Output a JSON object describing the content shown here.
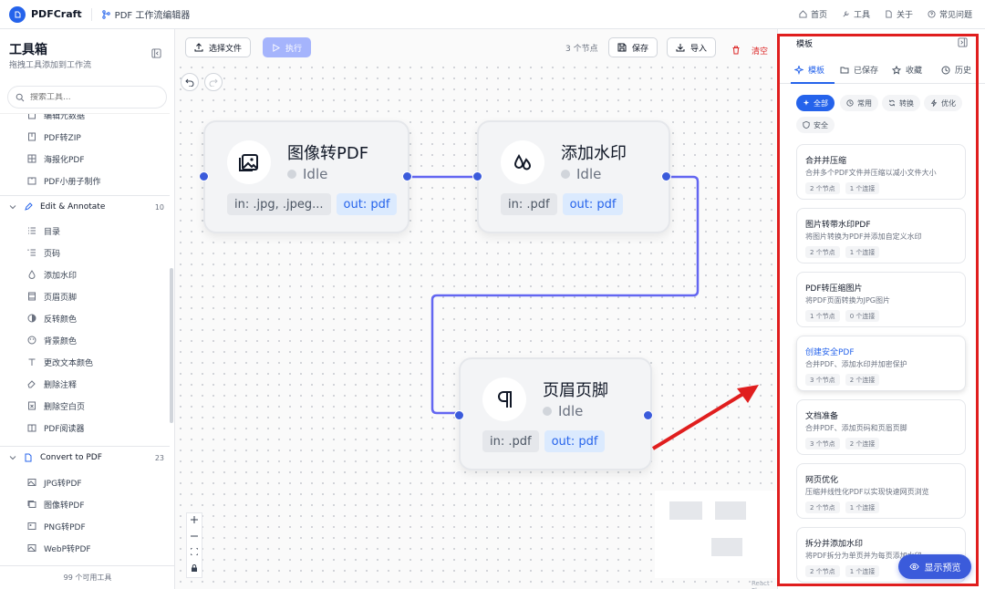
{
  "topbar": {
    "brand": "PDFCraft",
    "breadcrumb": "PDF 工作流编辑器",
    "nav": {
      "home": "首页",
      "tools": "工具",
      "about": "关于",
      "faq": "常见问题"
    }
  },
  "sidebar": {
    "title": "工具箱",
    "subtitle": "拖拽工具添加到工作流",
    "search_placeholder": "搜索工具...",
    "items_top": [
      {
        "label": "编辑元数据",
        "icon": "metadata-icon"
      },
      {
        "label": "PDF转ZIP",
        "icon": "zip-icon"
      },
      {
        "label": "海报化PDF",
        "icon": "poster-icon"
      },
      {
        "label": "PDF小册子制作",
        "icon": "booklet-icon"
      }
    ],
    "category_edit": {
      "label": "Edit & Annotate",
      "count": "10"
    },
    "items_edit": [
      {
        "label": "目录",
        "icon": "list-icon"
      },
      {
        "label": "页码",
        "icon": "numbered-list-icon"
      },
      {
        "label": "添加水印",
        "icon": "droplet-icon"
      },
      {
        "label": "页眉页脚",
        "icon": "header-footer-icon"
      },
      {
        "label": "反转颜色",
        "icon": "invert-icon"
      },
      {
        "label": "背景颜色",
        "icon": "palette-icon"
      },
      {
        "label": "更改文本颜色",
        "icon": "text-icon"
      },
      {
        "label": "删除注释",
        "icon": "eraser-icon"
      },
      {
        "label": "删除空白页",
        "icon": "delete-page-icon"
      },
      {
        "label": "PDF阅读器",
        "icon": "book-icon"
      }
    ],
    "category_convert": {
      "label": "Convert to PDF",
      "count": "23"
    },
    "items_convert": [
      {
        "label": "JPG转PDF",
        "icon": "image-icon"
      },
      {
        "label": "图像转PDF",
        "icon": "images-icon"
      },
      {
        "label": "PNG转PDF",
        "icon": "png-icon"
      },
      {
        "label": "WebP转PDF",
        "icon": "webp-icon"
      }
    ],
    "footer": "99 个可用工具"
  },
  "toolbar": {
    "select_file": "选择文件",
    "run": "执行",
    "node_count": "3 个节点",
    "save": "保存",
    "import": "导入",
    "clear": "清空"
  },
  "nodes": [
    {
      "title": "图像转PDF",
      "status": "Idle",
      "in": "in: .jpg, .jpeg...",
      "out": "out: pdf",
      "icon": "image-icon"
    },
    {
      "title": "添加水印",
      "status": "Idle",
      "in": "in: .pdf",
      "out": "out: pdf",
      "icon": "droplet-icon"
    },
    {
      "title": "页眉页脚",
      "status": "Idle",
      "in": "in: .pdf",
      "out": "out: pdf",
      "icon": "pilcrow-icon"
    }
  ],
  "canvas": {
    "attribution": "React Flow"
  },
  "templates_panel": {
    "title": "模板",
    "tabs": [
      "模板",
      "已保存",
      "收藏",
      "历史"
    ],
    "filters": [
      "全部",
      "常用",
      "转换",
      "优化",
      "安全"
    ],
    "cards": [
      {
        "title": "合并并压缩",
        "desc": "合并多个PDF文件并压缩以减小文件大小",
        "nodes": "2 个节点",
        "links": "1 个连接"
      },
      {
        "title": "图片转带水印PDF",
        "desc": "将图片转换为PDF并添加自定义水印",
        "nodes": "2 个节点",
        "links": "1 个连接"
      },
      {
        "title": "PDF转压缩图片",
        "desc": "将PDF页面转换为JPG图片",
        "nodes": "1 个节点",
        "links": "0 个连接"
      },
      {
        "title": "创建安全PDF",
        "desc": "合并PDF、添加水印并加密保护",
        "nodes": "3 个节点",
        "links": "2 个连接"
      },
      {
        "title": "文档准备",
        "desc": "合并PDF、添加页码和页眉页脚",
        "nodes": "3 个节点",
        "links": "2 个连接"
      },
      {
        "title": "网页优化",
        "desc": "压缩并线性化PDF以实现快速网页浏览",
        "nodes": "2 个节点",
        "links": "1 个连接"
      },
      {
        "title": "拆分并添加水印",
        "desc": "将PDF拆分为单页并为每页添加水印",
        "nodes": "2 个节点",
        "links": "1 个连接"
      }
    ],
    "preview_button": "显示预览"
  },
  "colors": {
    "accent": "#3b5bdb",
    "annotation": "#e01e1e",
    "edge": "#6366f1"
  }
}
